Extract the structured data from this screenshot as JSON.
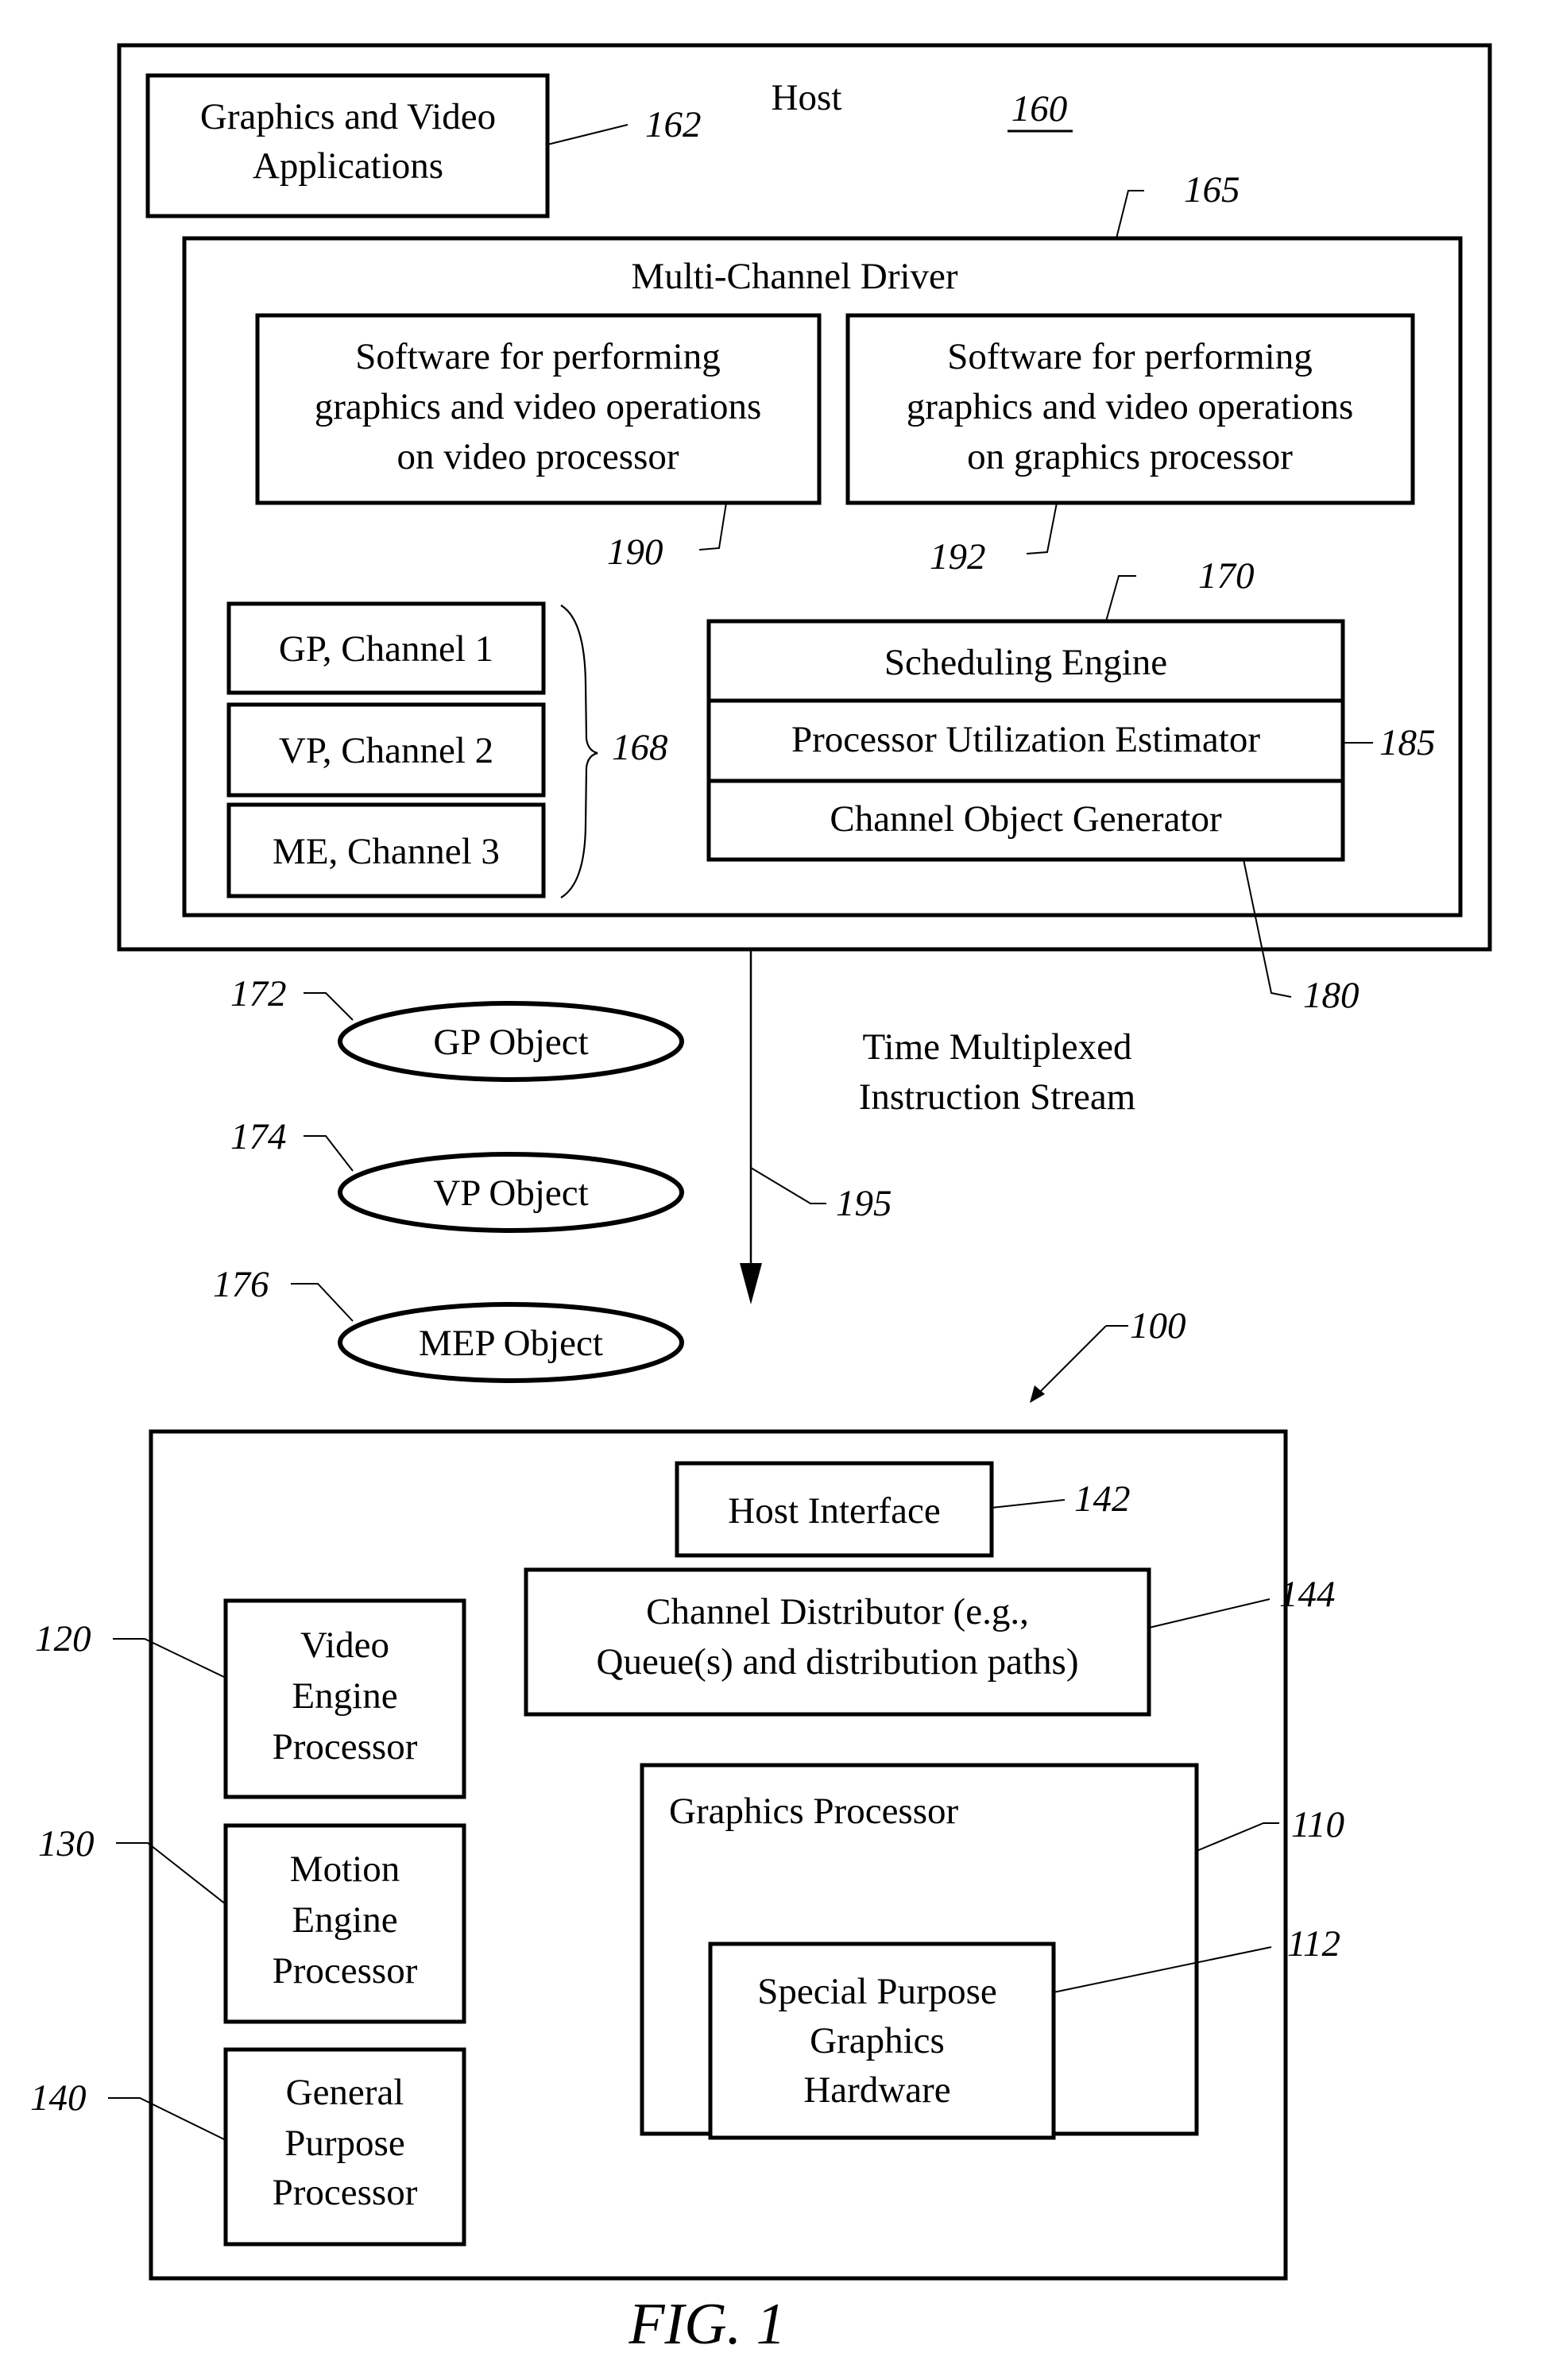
{
  "figure": {
    "caption": "FIG. 1"
  },
  "host": {
    "label": "Host",
    "ref": "160",
    "apps": {
      "lines": [
        "Graphics and Video",
        "Applications"
      ],
      "ref": "162"
    },
    "driver": {
      "label": "Multi-Channel Driver",
      "ref": "165",
      "sw_video": {
        "lines": [
          "Software for performing",
          "graphics and video operations",
          "on video processor"
        ],
        "ref": "190"
      },
      "sw_graphics": {
        "lines": [
          "Software for performing",
          "graphics and video operations",
          "on graphics processor"
        ],
        "ref": "192"
      },
      "channels": {
        "ref": "168",
        "items": [
          {
            "label": "GP, Channel 1"
          },
          {
            "label": "VP, Channel 2"
          },
          {
            "label": "ME, Channel 3"
          }
        ]
      },
      "scheduling_engine": {
        "label": "Scheduling Engine",
        "ref": "170"
      },
      "utilization_estimator": {
        "label": "Processor Utilization Estimator",
        "ref": "185"
      },
      "object_generator": {
        "label": "Channel Object Generator",
        "ref": "180"
      }
    }
  },
  "objects": [
    {
      "label": "GP Object",
      "ref": "172"
    },
    {
      "label": "VP Object",
      "ref": "174"
    },
    {
      "label": "MEP Object",
      "ref": "176"
    }
  ],
  "stream": {
    "lines": [
      "Time Multiplexed",
      "Instruction Stream"
    ],
    "ref": "195"
  },
  "device": {
    "ref": "100",
    "host_interface": {
      "label": "Host Interface",
      "ref": "142"
    },
    "channel_distributor": {
      "lines": [
        "Channel Distributor (e.g.,",
        "Queue(s) and distribution paths)"
      ],
      "ref": "144"
    },
    "video_engine": {
      "lines": [
        "Video",
        "Engine",
        "Processor"
      ],
      "ref": "120"
    },
    "motion_engine": {
      "lines": [
        "Motion",
        "Engine",
        "Processor"
      ],
      "ref": "130"
    },
    "general_purpose": {
      "lines": [
        "General",
        "Purpose",
        "Processor"
      ],
      "ref": "140"
    },
    "graphics_processor": {
      "label": "Graphics Processor",
      "ref": "110",
      "special_hw": {
        "lines": [
          "Special Purpose",
          "Graphics",
          "Hardware"
        ],
        "ref": "112"
      }
    }
  }
}
